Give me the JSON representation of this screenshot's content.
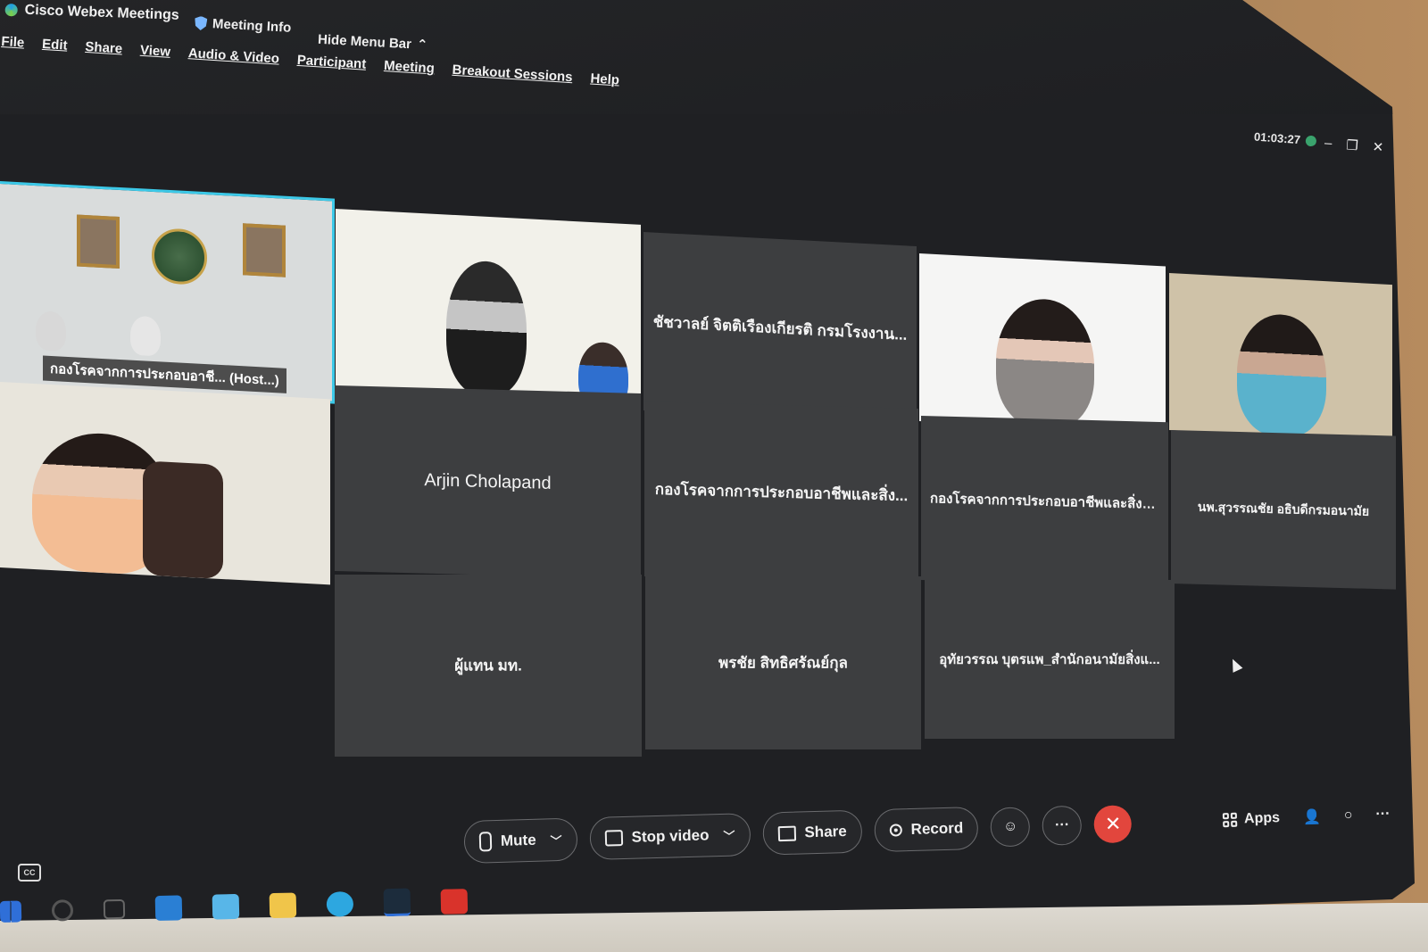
{
  "app": {
    "title": "Cisco Webex Meetings",
    "meeting_info": "Meeting Info",
    "hide_menu": "Hide Menu Bar"
  },
  "menu": [
    "File",
    "Edit",
    "Share",
    "View",
    "Audio & Video",
    "Participant",
    "Meeting",
    "Breakout Sessions",
    "Help"
  ],
  "status": {
    "timer": "01:03:27"
  },
  "participants": {
    "host_label": "กองโรคจากการประกอบอาชี... (Host...)",
    "p3": "ชัชวาลย์ จิตติเรืองเกียรติ กรมโรงงาน...",
    "p7": "Arjin Cholapand",
    "p8": "กองโรคจากการประกอบอาชีพและสิ่ง...",
    "p9": "กองโรคจากการประกอบอาชีพและสิ่งแว...",
    "p10": "นพ.สุวรรณชัย อธิบดีกรมอนามัย",
    "p11": "ผู้แทน มท.",
    "p12": "พรชัย สิทธิศรัณย์กุล",
    "p13": "อุทัยวรรณ บุตรแพ_สำนักอนามัยสิ่งแ..."
  },
  "toolbar": {
    "mute": "Mute",
    "stop_video": "Stop video",
    "share": "Share",
    "record": "Record",
    "more": "···",
    "leave": "✕",
    "apps": "Apps"
  },
  "colors": {
    "accent": "#3cc9e8",
    "leave": "#e2463d"
  }
}
